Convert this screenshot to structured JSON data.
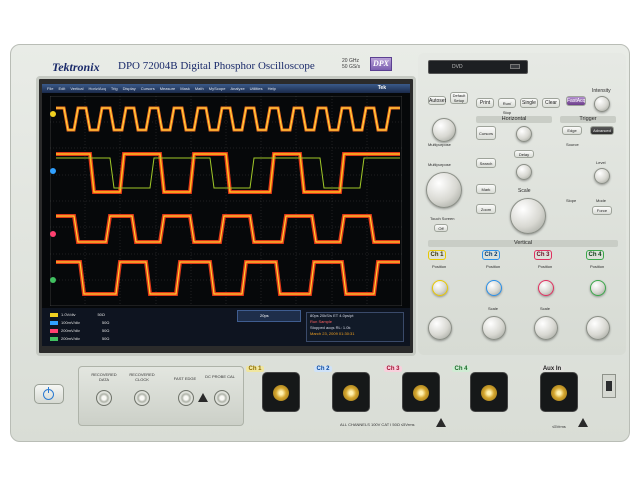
{
  "header": {
    "brand": "Tektronix",
    "model": "DPO 72004B  Digital Phosphor Oscilloscope",
    "spec_line1": "20 GHz",
    "spec_line2": "50 GS/s",
    "badge": "DPX"
  },
  "drive": {
    "label": "DVD"
  },
  "screen": {
    "menu": [
      "File",
      "Edit",
      "Vertical",
      "Horiz/Acq",
      "Trig",
      "Display",
      "Cursors",
      "Measure",
      "Mask",
      "Math",
      "MyScope",
      "Analyze",
      "Utilities",
      "Help"
    ],
    "logo": "Tek",
    "readouts": [
      {
        "label": "1.0V/div",
        "val": "50Ω",
        "color": "#f0d020"
      },
      {
        "label": "100mV/div",
        "val": "50Ω",
        "color": "#30a0ff"
      },
      {
        "label": "200mV/div",
        "val": "50Ω",
        "color": "#ff4070"
      },
      {
        "label": "200mV/div",
        "val": "50Ω",
        "color": "#40c060"
      }
    ],
    "timebase": "20ps",
    "info": {
      "row1": "80ps  20kS/s   ET  4.0ps/pt",
      "row2": "Run  Sample",
      "row3": "Stopped  acqs   RL: 1.0k",
      "row4": "March 23, 2009        01:30:31"
    }
  },
  "buttons": {
    "autoset": "Autoset",
    "default_setup": "Default Setup",
    "print": "Print",
    "run_stop": "Run/ Stop",
    "single": "Single",
    "clear": "Clear",
    "fastacq": "FastAcq",
    "intensity": "Intensity",
    "multipurpose_a": "Multipurpose",
    "multipurpose_b": "Multipurpose",
    "cursors": "Cursors",
    "search": "Search",
    "mark": "Mark",
    "zoom": "Zoom",
    "touch_screen": "Touch Screen",
    "off": "Off",
    "delay": "Delay",
    "edge": "Edge",
    "advanced": "Advanced",
    "source": "Source",
    "slope": "Slope",
    "level": "Level",
    "mode": "Mode",
    "force": "Force",
    "position": "Position",
    "offset": "Offset",
    "scale": "Scale"
  },
  "sections": {
    "horizontal": "Horizontal",
    "trigger": "Trigger",
    "vertical": "Vertical"
  },
  "channels": [
    {
      "label": "Ch 1",
      "color": "#e8c800"
    },
    {
      "label": "Ch 2",
      "color": "#2a8fe8"
    },
    {
      "label": "Ch 3",
      "color": "#e03060"
    },
    {
      "label": "Ch 4",
      "color": "#3aa84a"
    }
  ],
  "front": {
    "recovered_data": "RECOVERED DATA",
    "recovered_clock": "RECOVERED CLOCK",
    "fast_edge": "FAST EDGE",
    "dc_probe_cal": "DC PROBE CAL",
    "aux_in": "Aux In",
    "footer": "ALL CHANNELS  100V CAT I  50Ω  ≤5Vrms",
    "aux_footer": "≤5Vrms"
  }
}
